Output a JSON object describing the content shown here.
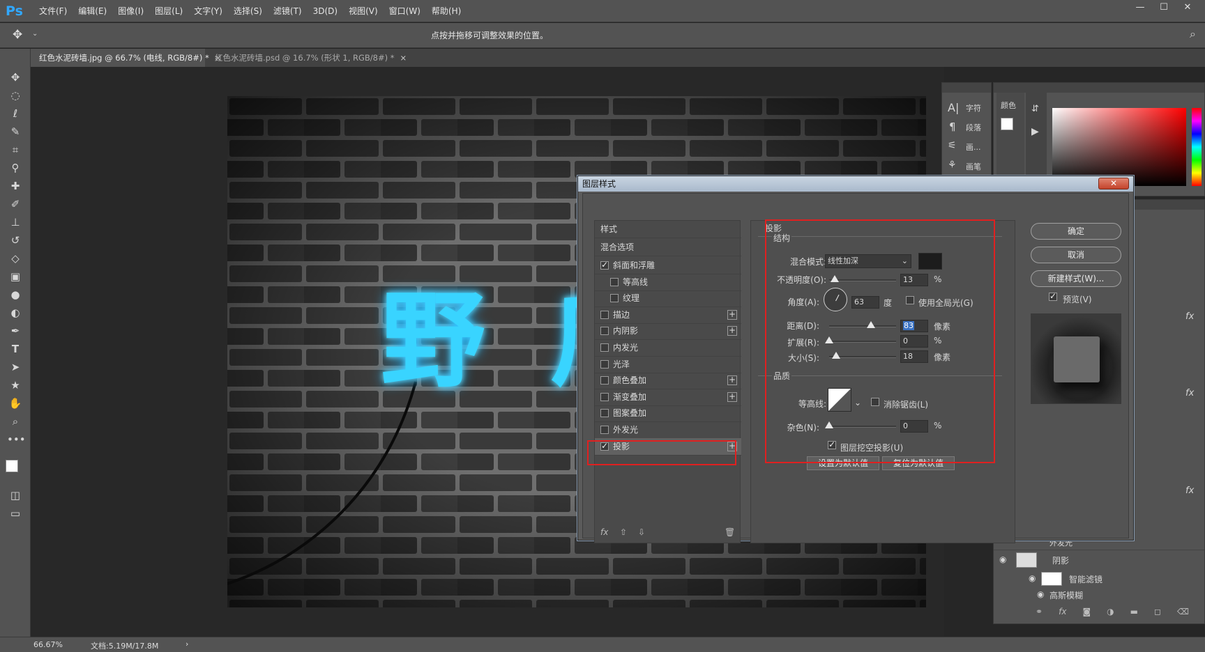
{
  "app": {
    "logo": "Ps",
    "menu": [
      "文件(F)",
      "编辑(E)",
      "图像(I)",
      "图层(L)",
      "文字(Y)",
      "选择(S)",
      "滤镜(T)",
      "3D(D)",
      "视图(V)",
      "窗口(W)",
      "帮助(H)"
    ],
    "window_controls": [
      "—",
      "☐",
      "✕"
    ]
  },
  "options_bar": {
    "hint": "点按并拖移可调整效果的位置。"
  },
  "tabs": [
    {
      "label": "红色水泥砖墙.jpg @ 66.7% (电线, RGB/8#) *",
      "close": "×"
    },
    {
      "label": "红色水泥砖墙.psd @ 16.7% (形状 1, RGB/8#) *",
      "close": "×"
    }
  ],
  "canvas": {
    "text": "野 ⺁"
  },
  "status": {
    "zoom": "66.67%",
    "doc": "文档:5.19M/17.8M",
    "arrow": "›"
  },
  "char_panel": {
    "items": [
      "字符",
      "段落",
      "画...",
      "画笔"
    ]
  },
  "color_panel": {
    "tab": "颜色"
  },
  "layers_panel": {
    "rows": [
      {
        "name": "外发光"
      },
      {
        "name": "阴影"
      },
      {
        "name": "智能滤镜"
      },
      {
        "name": "高斯模糊"
      }
    ],
    "fx": "fx"
  },
  "dialog": {
    "title": "图层样式",
    "close": "✕",
    "styles_header": "样式",
    "blend_options": "混合选项",
    "styles": [
      {
        "label": "斜面和浮雕",
        "checked": true,
        "indent": 0,
        "plus": false
      },
      {
        "label": "等高线",
        "checked": false,
        "indent": 1,
        "plus": false
      },
      {
        "label": "纹理",
        "checked": false,
        "indent": 1,
        "plus": false
      },
      {
        "label": "描边",
        "checked": false,
        "indent": 0,
        "plus": true
      },
      {
        "label": "内阴影",
        "checked": false,
        "indent": 0,
        "plus": true
      },
      {
        "label": "内发光",
        "checked": false,
        "indent": 0,
        "plus": false
      },
      {
        "label": "光泽",
        "checked": false,
        "indent": 0,
        "plus": false
      },
      {
        "label": "颜色叠加",
        "checked": false,
        "indent": 0,
        "plus": true
      },
      {
        "label": "渐变叠加",
        "checked": false,
        "indent": 0,
        "plus": true
      },
      {
        "label": "图案叠加",
        "checked": false,
        "indent": 0,
        "plus": false
      },
      {
        "label": "外发光",
        "checked": false,
        "indent": 0,
        "plus": false
      },
      {
        "label": "投影",
        "checked": true,
        "indent": 0,
        "plus": true,
        "selected": true
      }
    ],
    "list_footer": {
      "fx": "fx",
      "up": "⇧",
      "down": "⇩",
      "trash": "🗑"
    },
    "section_title": "投影",
    "structure": {
      "title": "结构",
      "blend_mode_label": "混合模式:",
      "blend_mode_value": "线性加深",
      "opacity_label": "不透明度(O):",
      "opacity_value": "13",
      "opacity_unit": "%",
      "angle_label": "角度(A):",
      "angle_value": "63",
      "angle_unit": "度",
      "global_light_label": "使用全局光(G)",
      "global_light_checked": false,
      "distance_label": "距离(D):",
      "distance_value": "83",
      "distance_unit": "像素",
      "spread_label": "扩展(R):",
      "spread_value": "0",
      "spread_unit": "%",
      "size_label": "大小(S):",
      "size_value": "18",
      "size_unit": "像素",
      "shadow_color": "#1c1c1c"
    },
    "quality": {
      "title": "品质",
      "contour_label": "等高线:",
      "antialias_label": "消除锯齿(L)",
      "antialias_checked": false,
      "noise_label": "杂色(N):",
      "noise_value": "0",
      "noise_unit": "%"
    },
    "knockout_label": "图层挖空投影(U)",
    "knockout_checked": true,
    "set_default": "设置为默认值",
    "reset_default": "复位为默认值",
    "buttons": {
      "ok": "确定",
      "cancel": "取消",
      "new_style": "新建样式(W)...",
      "preview": "预览(V)"
    },
    "preview_checked": true
  },
  "colors": {
    "neon": "#39d4ff",
    "highlight": "#e02020"
  }
}
